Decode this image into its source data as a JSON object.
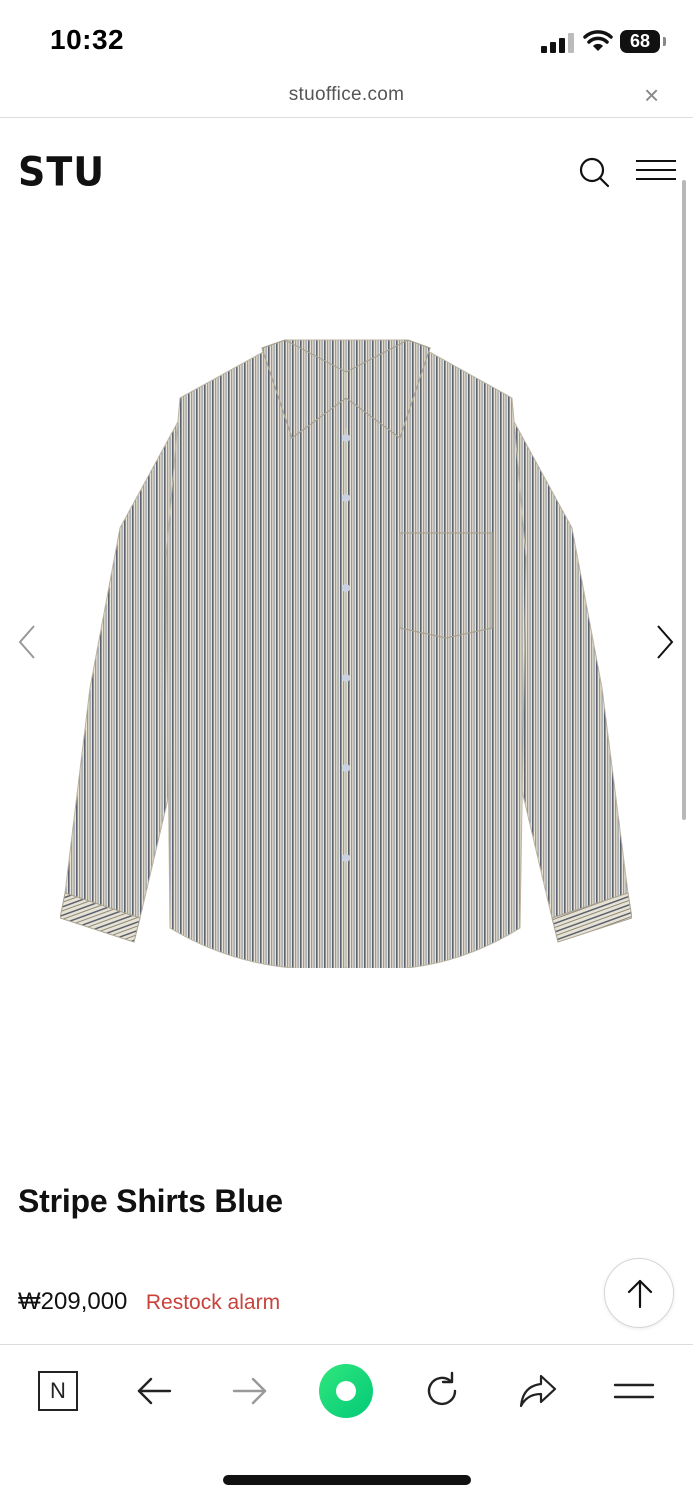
{
  "status_bar": {
    "time": "10:32",
    "battery": "68",
    "icons": [
      "signal-icon",
      "wifi-icon",
      "battery-icon"
    ]
  },
  "url_bar": {
    "url": "stuoffice.com",
    "close_icon": "close-icon"
  },
  "site_header": {
    "logo": "STU",
    "icons": [
      "search-icon",
      "hamburger-menu-icon"
    ]
  },
  "gallery": {
    "image": "striped-shirt-image",
    "prev_icon": "chevron-left-icon",
    "next_icon": "chevron-right-icon"
  },
  "product": {
    "title": "Stripe Shirts Blue",
    "price": "₩209,000",
    "restock_label": "Restock alarm"
  },
  "scroll_top_icon": "arrow-up-icon",
  "toolbar": {
    "n_label": "N",
    "icons": [
      "naver-n-icon",
      "back-arrow-icon",
      "forward-arrow-icon",
      "green-dot-icon",
      "reload-icon",
      "share-icon",
      "menu-icon"
    ]
  },
  "colors": {
    "accent_red": "#c8423a",
    "green": "#04c978",
    "text": "#111111"
  }
}
